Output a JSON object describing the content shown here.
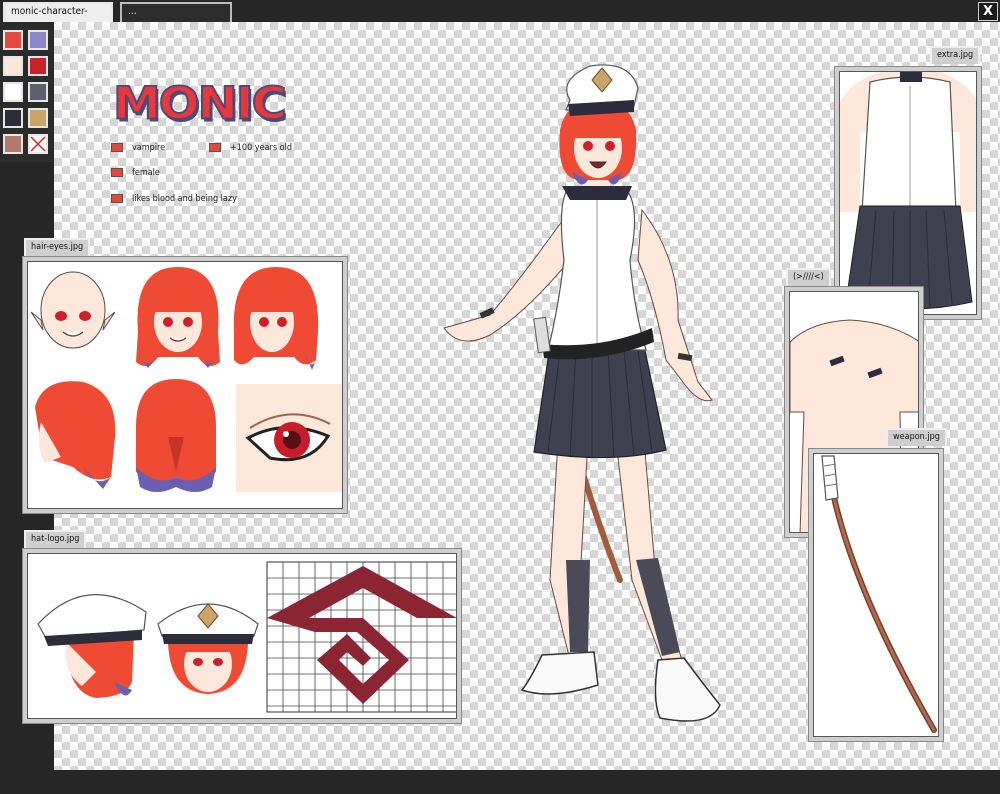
{
  "tabs": [
    {
      "label": "monic-character-sheet.rip",
      "active": true
    },
    {
      "label": "...",
      "active": false
    }
  ],
  "close_label": "X",
  "palette": [
    {
      "color": "#e8473e"
    },
    {
      "color": "#8b87c9"
    },
    {
      "color": "#fbe6dc"
    },
    {
      "color": "#c8232b"
    },
    {
      "color": "#ffffff"
    },
    {
      "color": "#5e5e6c"
    },
    {
      "color": "#2b2d38"
    },
    {
      "color": "#c9a56a"
    },
    {
      "color": "#b07b6c"
    },
    {
      "color": "none"
    }
  ],
  "sheet": {
    "title": "MONIC",
    "traits": [
      "vampire",
      "+100 years old",
      "female",
      "likes blood and being lazy"
    ]
  },
  "panels": {
    "hair_eyes": "hair-eyes.jpg",
    "hat_logo": "hat-logo.jpg",
    "extra": "extra.jpg",
    "undressed": "(>////<)",
    "weapon": "weapon.jpg"
  },
  "colors": {
    "hair": "#ee4a34",
    "hair_tip": "#6b5fb1",
    "skin": "#fde8db",
    "logo": "#8b2433",
    "skirt": "#3f4150",
    "sword": "#a35b3f"
  }
}
